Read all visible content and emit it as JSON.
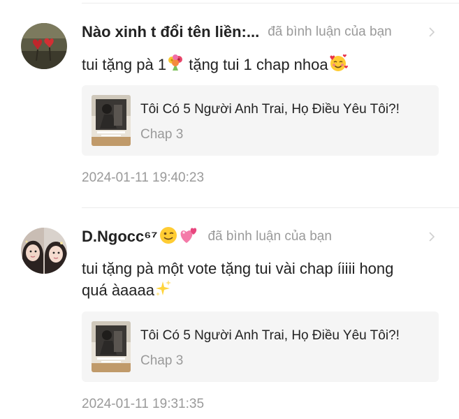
{
  "comments": [
    {
      "username": "Nào xinh t đổi tên liền:...",
      "action": "đã bình luận của bạn",
      "text": "tui tặng pà 1",
      "text_after": " tặng tui 1 chap nhoa",
      "emoji_inline": "bouquet-emoji",
      "emoji_end": "smiling-face-with-hearts-emoji",
      "manga_title": "Tôi Có 5 Người Anh Trai, Họ Điều Yêu Tôi?!",
      "chapter": "Chap 3",
      "timestamp": "2024-01-11 19:40:23"
    },
    {
      "username": "D.Ngocc⁶⁷",
      "username_emojis": [
        "winking-face-emoji",
        "revolving-hearts-emoji"
      ],
      "action": "đã bình luận của bạn",
      "text": "tui tặng pà một vote tặng tui vài chap íiiii hong quá àaaaa",
      "emoji_end": "sparkles-emoji",
      "manga_title": "Tôi Có 5 Người Anh Trai, Họ Điều Yêu Tôi?!",
      "chapter": "Chap 3",
      "timestamp": "2024-01-11 19:31:35"
    }
  ],
  "colors": {
    "text_primary": "#222222",
    "text_secondary": "#9a9a9a",
    "card_bg": "#f5f5f5",
    "divider": "#ececec"
  }
}
